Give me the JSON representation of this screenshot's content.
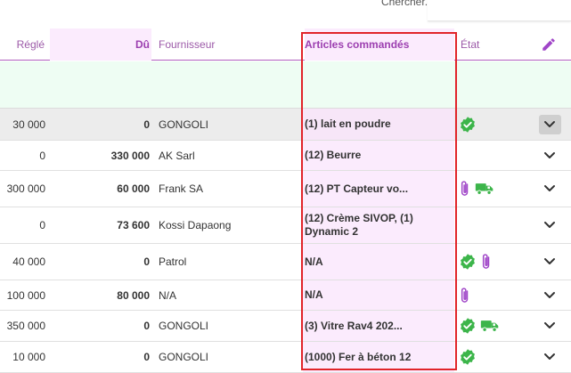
{
  "search": {
    "label": "Chercher."
  },
  "columns": {
    "regle": "Réglé",
    "du": "Dû",
    "fournisseur": "Fournisseur",
    "articles": "Articles commandés",
    "etat": "État"
  },
  "rows": [
    {
      "regle": "30 000",
      "du": "0",
      "fournisseur": "GONGOLI",
      "articles": "(1) lait en poudre",
      "etat": [
        "check"
      ]
    },
    {
      "regle": "0",
      "du": "330 000",
      "fournisseur": "AK Sarl",
      "articles": "(12) Beurre",
      "etat": []
    },
    {
      "regle": "300 000",
      "du": "60 000",
      "fournisseur": "Frank SA",
      "articles": "(12) PT Capteur vo...",
      "etat": [
        "clip",
        "truck"
      ]
    },
    {
      "regle": "0",
      "du": "73 600",
      "fournisseur": "Kossi Dapaong",
      "articles": "(12) Crème SIVOP, (1) Dynamic 2",
      "etat": []
    },
    {
      "regle": "40 000",
      "du": "0",
      "fournisseur": "Patrol",
      "articles": "N/A",
      "etat": [
        "check",
        "clip"
      ]
    },
    {
      "regle": "100 000",
      "du": "80 000",
      "fournisseur": "N/A",
      "articles": "N/A",
      "etat": [
        "clip"
      ]
    },
    {
      "regle": "350 000",
      "du": "0",
      "fournisseur": "GONGOLI",
      "articles": "(3) Vitre Rav4 202...",
      "etat": [
        "check",
        "truck"
      ]
    },
    {
      "regle": "10 000",
      "du": "0",
      "fournisseur": "GONGOLI",
      "articles": "(1000) Fer à béton 12",
      "etat": [
        "check"
      ]
    }
  ],
  "colors": {
    "accent": "#9c3fb0",
    "check": "#3cb54a",
    "truck": "#3cb54a",
    "clip": "#a046c8",
    "highlight": "#e1242a"
  }
}
